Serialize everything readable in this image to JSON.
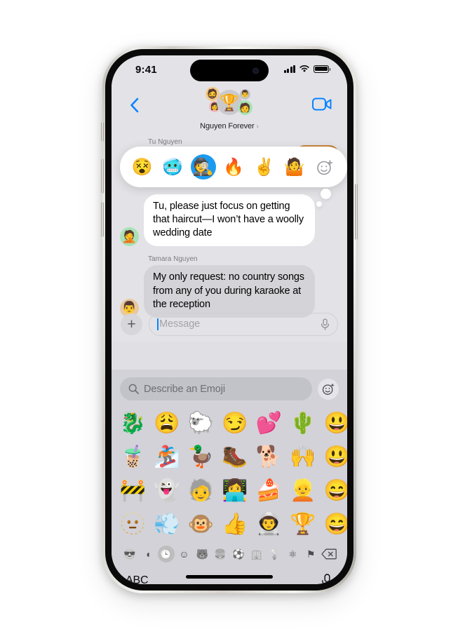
{
  "status_bar": {
    "time": "9:41",
    "signal_icon": "cellular-bars-icon",
    "wifi_icon": "wifi-icon",
    "battery_icon": "battery-icon"
  },
  "nav_bar": {
    "back_icon": "chevron-left-icon",
    "facetime_icon": "video-camera-icon",
    "group_name": "Nguyen Forever",
    "group_chevron": "›",
    "group_avatar": {
      "center": "🏆",
      "top_left": "🧔",
      "bottom_left": "👩",
      "top_right": "👨",
      "bottom_right": "🧑"
    }
  },
  "conversation": {
    "partial_sender": "Tu Nguyen",
    "messages": [
      {
        "sender": "",
        "text": "Tu, please just focus on getting that haircut—I won’t have a woolly wedding date",
        "avatar": "🤦",
        "style": "white"
      },
      {
        "sender": "Tamara Nguyen",
        "text": "My only request: no country songs from any of you during karaoke at the reception",
        "avatar": "👨",
        "style": "grey"
      }
    ],
    "tapback": {
      "options": [
        {
          "emoji": "😵",
          "name": "dizzy-face-emoji",
          "selected": false
        },
        {
          "emoji": "🥶",
          "name": "cold-face-emoji",
          "selected": false
        },
        {
          "emoji": "🕵️",
          "name": "sheep-detective-emoji",
          "selected": true
        },
        {
          "emoji": "🔥",
          "name": "fire-emoji",
          "selected": false
        },
        {
          "emoji": "✌️",
          "name": "victory-hand-emoji",
          "selected": false
        },
        {
          "emoji": "🤷",
          "name": "shrug-emoji",
          "selected": false
        }
      ],
      "add_label": "☺",
      "add_name": "add-reaction-icon"
    }
  },
  "composer": {
    "plus_label": "+",
    "placeholder": "Message",
    "mic_icon": "microphone-icon"
  },
  "keyboard": {
    "search_placeholder": "Describe an Emoji",
    "search_icon": "magnifier-icon",
    "genmoji_icon": "genmoji-sparkle-icon",
    "emoji_rows": [
      [
        "🐉",
        "😩",
        "🐑",
        "😏",
        "💕",
        "🌵",
        "😃"
      ],
      [
        "🧋",
        "🏂",
        "🦆",
        "🥾",
        "🐕",
        "🙌",
        "😃"
      ],
      [
        "🚧",
        "👻",
        "🧓",
        "👩‍💻",
        "🍰",
        "👱",
        "😄"
      ],
      [
        "🫥",
        "💨",
        "🐵",
        "👍",
        "👨‍🚀",
        "🏆",
        "😄"
      ]
    ],
    "categories": [
      {
        "glyph": "😎",
        "name": "category-memoji",
        "selected": false
      },
      {
        "glyph": "◖",
        "name": "category-stickers",
        "selected": false
      },
      {
        "glyph": "🕒",
        "name": "category-recents",
        "selected": true
      },
      {
        "glyph": "☺",
        "name": "category-smileys",
        "selected": false
      },
      {
        "glyph": "🐻",
        "name": "category-animals",
        "selected": false
      },
      {
        "glyph": "🍔",
        "name": "category-food",
        "selected": false
      },
      {
        "glyph": "⚽",
        "name": "category-activity",
        "selected": false
      },
      {
        "glyph": "🏢",
        "name": "category-travel",
        "selected": false
      },
      {
        "glyph": "💡",
        "name": "category-objects",
        "selected": false
      },
      {
        "glyph": "⚛",
        "name": "category-symbols",
        "selected": false
      },
      {
        "glyph": "⚑",
        "name": "category-flags",
        "selected": false
      }
    ],
    "delete_icon": "backspace-icon",
    "abc_label": "ABC",
    "dictation_icon": "microphone-icon"
  },
  "colors": {
    "accent_blue": "#0a84ff",
    "tapback_selected": "#1a9bf0",
    "screen_bg": "#e3e3e7",
    "keyboard_bg": "#d2d2d8",
    "bubble_grey": "#d3d3d8"
  }
}
